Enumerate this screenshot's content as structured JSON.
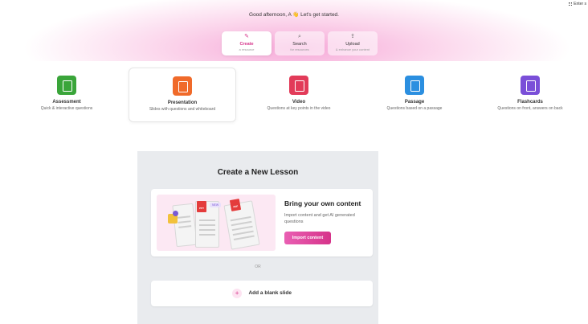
{
  "header": {
    "greeting": "Good afternoon, A 👋 Let's get started.",
    "corner_label": "Enter s"
  },
  "tabs": [
    {
      "label": "Create",
      "sub": "a resource",
      "icon": "pencil-icon",
      "active": true
    },
    {
      "label": "Search",
      "sub": "for resources",
      "icon": "search-icon",
      "active": false
    },
    {
      "label": "Upload",
      "sub": "& enhance your content",
      "icon": "upload-icon",
      "active": false
    }
  ],
  "resource_types": [
    {
      "name": "Assessment",
      "desc": "Quick & interactive questions",
      "color": "#3aa53a",
      "icon": "assessment-icon"
    },
    {
      "name": "Presentation",
      "desc": "Slides with questions and whiteboard",
      "color": "#f06a2a",
      "icon": "presentation-icon"
    },
    {
      "name": "Video",
      "desc": "Questions at key points in the video",
      "color": "#e23b59",
      "icon": "video-icon"
    },
    {
      "name": "Passage",
      "desc": "Questions based on a passage",
      "color": "#2b8fe0",
      "icon": "passage-icon"
    },
    {
      "name": "Flashcards",
      "desc": "Questions on front, answers on back",
      "color": "#7a4fd8",
      "icon": "flashcards-icon"
    }
  ],
  "lesson": {
    "title": "Create a New Lesson",
    "import_card": {
      "title": "Bring your own content",
      "desc": "Import content and get AI generated questions",
      "button": "Import content",
      "badges": [
        "PPT",
        "PDF"
      ],
      "new_tag": "NEW"
    },
    "divider": "OR",
    "blank_button": "Add a blank slide",
    "blank_icon": "+"
  },
  "colors": {
    "accent": "#d6338a",
    "panel": "#e9ebee"
  }
}
